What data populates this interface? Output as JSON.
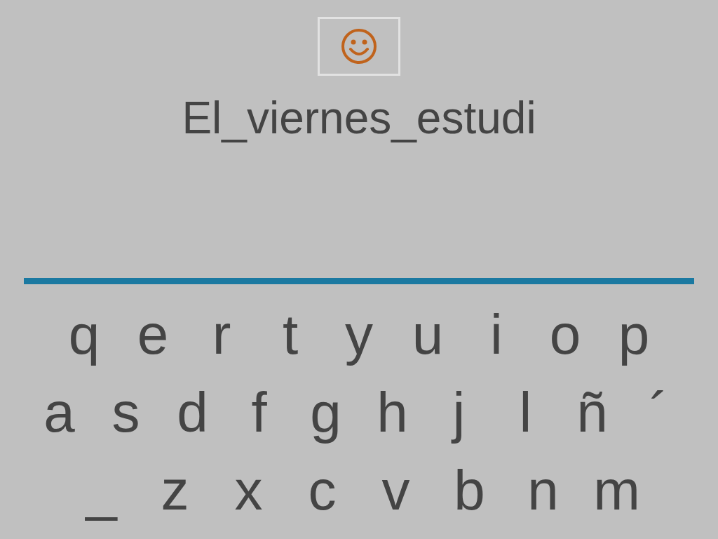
{
  "answer": "El_viernes_estudi",
  "keyboard": [
    [
      "q",
      "e",
      "r",
      "t",
      "y",
      "u",
      "i",
      "o",
      "p"
    ],
    [
      "a",
      "s",
      "d",
      "f",
      "g",
      "h",
      "j",
      "l",
      "ñ",
      "´"
    ],
    [
      "_",
      "z",
      "x",
      "c",
      "v",
      "b",
      "n",
      "m"
    ]
  ]
}
